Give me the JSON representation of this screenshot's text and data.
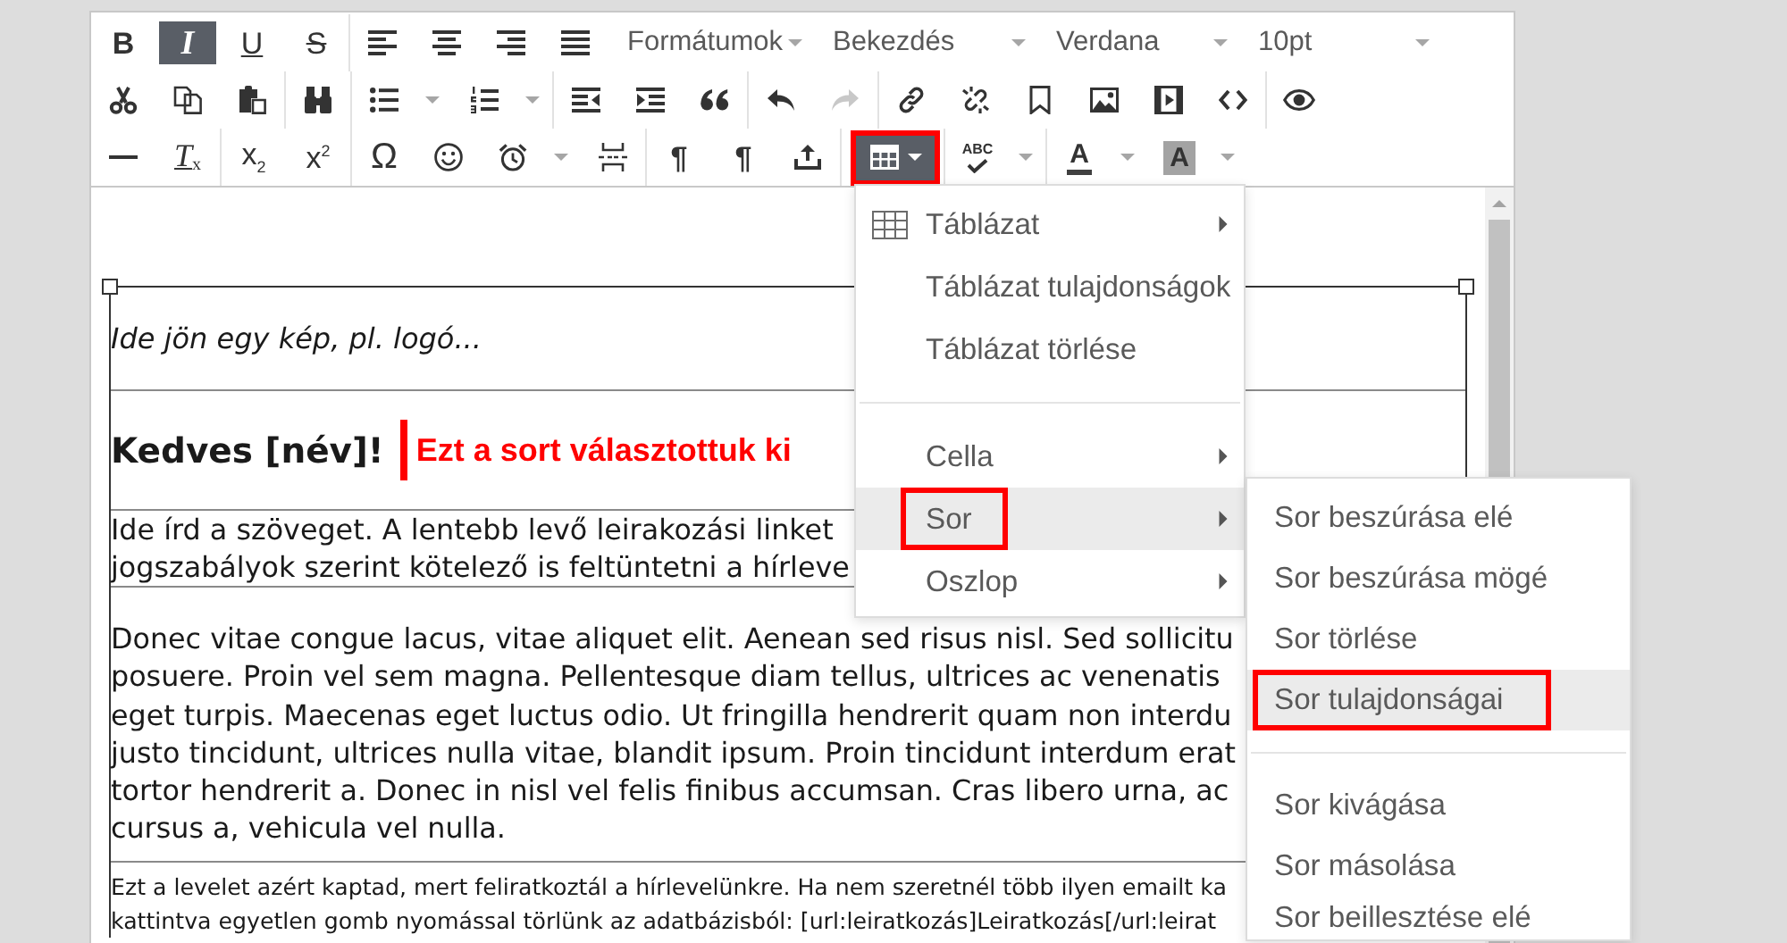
{
  "toolbar": {
    "rows": [
      {
        "groups": [
          [
            {
              "kind": "bold",
              "label": "B",
              "active": false,
              "disabled": false,
              "highlighted": false
            },
            {
              "kind": "italic",
              "label": "I",
              "active": true,
              "disabled": false,
              "highlighted": false
            },
            {
              "kind": "underline",
              "label": "U",
              "active": false,
              "disabled": false,
              "highlighted": false
            },
            {
              "kind": "strike",
              "label": "S",
              "active": false,
              "disabled": false,
              "highlighted": false
            }
          ],
          [
            {
              "kind": "alignleft",
              "active": false,
              "disabled": false,
              "highlighted": false
            },
            {
              "kind": "aligncenter",
              "active": false,
              "disabled": false,
              "highlighted": false
            },
            {
              "kind": "alignright",
              "active": false,
              "disabled": false,
              "highlighted": false
            },
            {
              "kind": "justify",
              "active": false,
              "disabled": false,
              "highlighted": false
            }
          ]
        ],
        "selects": [
          {
            "value": "Formátumok"
          },
          {
            "value": "Bekezdés"
          },
          {
            "value": "Verdana"
          },
          {
            "value": "10pt"
          }
        ]
      },
      {
        "groups": [
          [
            {
              "kind": "cut",
              "active": false,
              "disabled": false,
              "highlighted": false
            },
            {
              "kind": "copy",
              "active": false,
              "disabled": false,
              "highlighted": false
            },
            {
              "kind": "paste",
              "active": false,
              "disabled": false,
              "highlighted": false
            }
          ],
          [
            {
              "kind": "find",
              "active": false,
              "disabled": false,
              "highlighted": false
            }
          ],
          [
            {
              "kind": "bullets",
              "dropdown": true,
              "active": false,
              "disabled": false,
              "highlighted": false
            },
            {
              "kind": "numbers",
              "dropdown": true,
              "active": false,
              "disabled": false,
              "highlighted": false
            }
          ],
          [
            {
              "kind": "outdent",
              "active": false,
              "disabled": false,
              "highlighted": false
            },
            {
              "kind": "indent",
              "active": false,
              "disabled": false,
              "highlighted": false
            },
            {
              "kind": "quote",
              "active": false,
              "disabled": false,
              "highlighted": false
            }
          ],
          [
            {
              "kind": "undo",
              "active": false,
              "disabled": false,
              "highlighted": false
            },
            {
              "kind": "redo",
              "active": false,
              "disabled": true,
              "highlighted": false
            }
          ],
          [
            {
              "kind": "link",
              "active": false,
              "disabled": false,
              "highlighted": false
            },
            {
              "kind": "unlink",
              "active": false,
              "disabled": false,
              "highlighted": false
            },
            {
              "kind": "bookmark",
              "active": false,
              "disabled": false,
              "highlighted": false
            },
            {
              "kind": "image",
              "active": false,
              "disabled": false,
              "highlighted": false
            },
            {
              "kind": "media",
              "active": false,
              "disabled": false,
              "highlighted": false
            },
            {
              "kind": "code",
              "active": false,
              "disabled": false,
              "highlighted": false
            }
          ],
          [
            {
              "kind": "preview",
              "active": false,
              "disabled": false,
              "highlighted": false
            }
          ]
        ]
      },
      {
        "groups": [
          [
            {
              "kind": "rule",
              "active": false,
              "disabled": false,
              "highlighted": false
            },
            {
              "kind": "clearformat",
              "label": "T$_{x}$",
              "active": false,
              "disabled": false,
              "highlighted": false
            }
          ],
          [
            {
              "kind": "subscript",
              "label": "x$_{2}$",
              "active": false,
              "disabled": false,
              "highlighted": false
            },
            {
              "kind": "superscript",
              "label": "x$^{2}$",
              "active": false,
              "disabled": false,
              "highlighted": false
            }
          ],
          [
            {
              "kind": "symbol",
              "label": "Ω",
              "active": false,
              "disabled": false,
              "highlighted": false
            },
            {
              "kind": "emoji",
              "active": false,
              "disabled": false,
              "highlighted": false
            },
            {
              "kind": "alarm",
              "dropdown": true,
              "active": false,
              "disabled": false,
              "highlighted": false
            },
            {
              "kind": "pagebreak",
              "active": false,
              "disabled": false,
              "highlighted": false
            }
          ],
          [
            {
              "kind": "pilcrow",
              "label": "¶",
              "active": false,
              "disabled": false,
              "highlighted": false
            },
            {
              "kind": "pilcrow",
              "label": "¶",
              "active": false,
              "disabled": false,
              "highlighted": false
            },
            {
              "kind": "insert",
              "active": false,
              "disabled": false,
              "highlighted": false
            }
          ],
          [
            {
              "kind": "table",
              "dropdown": true,
              "active": true,
              "disabled": false,
              "highlighted": true
            }
          ],
          [
            {
              "kind": "spellcheck",
              "label": "ABC",
              "dropdown": true,
              "active": false,
              "disabled": false,
              "highlighted": false
            }
          ],
          [
            {
              "kind": "forecolor",
              "label": "A",
              "dropdown": true,
              "active": false,
              "disabled": false,
              "highlighted": false
            },
            {
              "kind": "backcolor",
              "label": "A",
              "dropdown": true,
              "active": false,
              "disabled": false,
              "highlighted": false
            }
          ]
        ]
      }
    ]
  },
  "document": {
    "table": {
      "rows": [
        {
          "kind": "caption",
          "text": "Ide jön egy kép, pl. logó..."
        },
        {
          "kind": "heading",
          "text": "Kedves [név]!",
          "annotation": "Ezt a sort választottuk ki"
        },
        {
          "kind": "lead",
          "lines": [
            "Ide írd a szöveget. A lentebb levő leirakozási linket",
            "jogszabályok szerint kötelező is feltüntetni a hírleve"
          ]
        },
        {
          "kind": "body",
          "lines": [
            "Donec vitae congue lacus, vitae aliquet elit. Aenean sed risus nisl. Sed sollicitu",
            "posuere. Proin vel sem magna. Pellentesque diam tellus, ultrices ac venenatis",
            "eget turpis. Maecenas eget luctus odio. Ut fringilla hendrerit quam non interdu",
            "justo tincidunt, ultrices nulla vitae, blandit ipsum. Proin tincidunt interdum erat",
            "tortor hendrerit a. Donec in nisl vel felis finibus accumsan. Cras libero urna, ac",
            "cursus a, vehicula vel nulla."
          ]
        },
        {
          "kind": "footer",
          "lines": [
            "Ezt a levelet azért kaptad, mert feliratkoztál a hírlevelünkre. Ha nem szeretnél több ilyen emailt ka",
            "kattintva egyetlen gomb nyomással törlünk az adatbázisból: [url:leiratkozás]Leiratkozás[/url:leirat"
          ]
        }
      ]
    }
  },
  "table_menu": {
    "items": [
      {
        "kind": "icon",
        "label": "Táblázat",
        "submenu": true,
        "selected": false,
        "highlighted": false
      },
      {
        "kind": "text",
        "label": "Táblázat tulajdonságok",
        "submenu": false,
        "selected": false,
        "highlighted": false
      },
      {
        "kind": "text",
        "label": "Táblázat törlése",
        "submenu": false,
        "selected": false,
        "highlighted": false
      },
      {
        "kind": "separator"
      },
      {
        "kind": "text",
        "label": "Cella",
        "submenu": true,
        "selected": false,
        "highlighted": false
      },
      {
        "kind": "text",
        "label": "Sor",
        "submenu": true,
        "selected": true,
        "highlighted": true
      },
      {
        "kind": "text",
        "label": "Oszlop",
        "submenu": true,
        "selected": false,
        "highlighted": false
      }
    ]
  },
  "row_submenu": {
    "items": [
      {
        "kind": "text",
        "label": "Sor beszúrása elé",
        "submenu": false,
        "selected": false,
        "highlighted": false
      },
      {
        "kind": "text",
        "label": "Sor beszúrása mögé",
        "submenu": false,
        "selected": false,
        "highlighted": false
      },
      {
        "kind": "text",
        "label": "Sor törlése",
        "submenu": false,
        "selected": false,
        "highlighted": false
      },
      {
        "kind": "text",
        "label": "Sor tulajdonságai",
        "submenu": false,
        "selected": true,
        "highlighted": true
      },
      {
        "kind": "separator"
      },
      {
        "kind": "text",
        "label": "Sor kivágása",
        "submenu": false,
        "selected": false,
        "highlighted": false
      },
      {
        "kind": "text",
        "label": "Sor másolása",
        "submenu": false,
        "selected": false,
        "highlighted": false
      },
      {
        "kind": "text",
        "label": "Sor beillesztése elé",
        "submenu": false,
        "selected": false,
        "highlighted": false
      }
    ]
  }
}
